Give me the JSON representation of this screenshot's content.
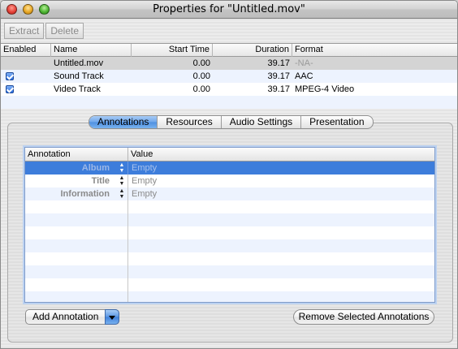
{
  "window": {
    "title": "Properties for \"Untitled.mov\""
  },
  "toolbar": {
    "extract_label": "Extract",
    "delete_label": "Delete"
  },
  "tracks": {
    "columns": [
      "Enabled",
      "Name",
      "Start Time",
      "Duration",
      "Format"
    ],
    "rows": [
      {
        "enabled": false,
        "name": "Untitled.mov",
        "start": "0.00",
        "duration": "39.17",
        "format": "-NA-"
      },
      {
        "enabled": true,
        "name": "Sound Track",
        "start": "0.00",
        "duration": "39.17",
        "format": "AAC"
      },
      {
        "enabled": true,
        "name": "Video Track",
        "start": "0.00",
        "duration": "39.17",
        "format": "MPEG-4 Video"
      }
    ]
  },
  "tabs": [
    "Annotations",
    "Resources",
    "Audio Settings",
    "Presentation"
  ],
  "active_tab": "Annotations",
  "annotations": {
    "columns": [
      "Annotation",
      "Value"
    ],
    "rows": [
      {
        "annotation": "Album",
        "value": "Empty"
      },
      {
        "annotation": "Title",
        "value": "Empty"
      },
      {
        "annotation": "Information",
        "value": "Empty"
      }
    ]
  },
  "buttons": {
    "add": "Add Annotation",
    "remove": "Remove Selected Annotations"
  },
  "icons": {
    "close": "close-light-icon",
    "minimize": "minimize-light-icon",
    "zoom": "zoom-light-icon",
    "checkbox": "checkbox-checked-icon",
    "stepper": "stepper-icon",
    "popup_arrow": "chevron-down-icon"
  },
  "colors": {
    "selection": "#3d7ddb",
    "tab_active": "#6ea6ea",
    "row_alt": "#edf3fe"
  }
}
